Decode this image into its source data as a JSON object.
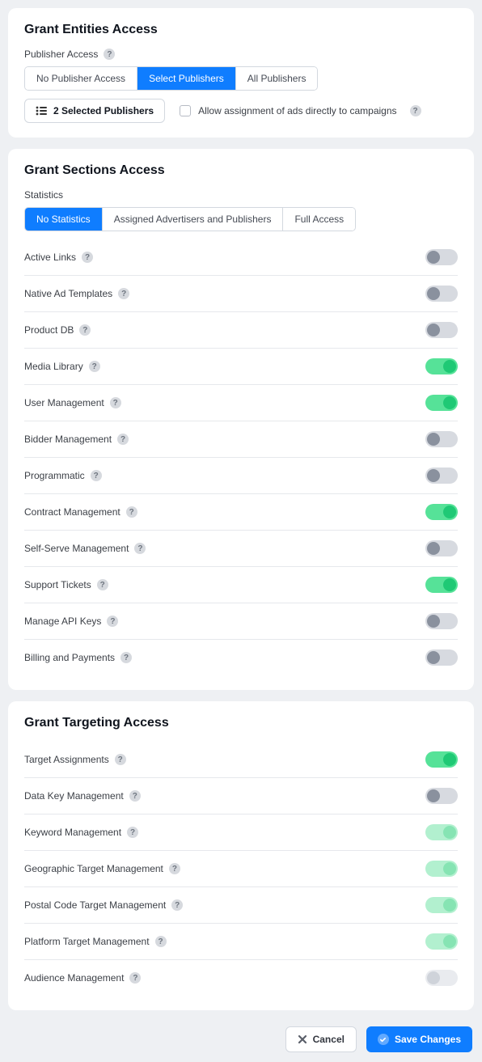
{
  "entities": {
    "title": "Grant Entities Access",
    "publisher_access_label": "Publisher Access",
    "segments": [
      "No Publisher Access",
      "Select Publishers",
      "All Publishers"
    ],
    "active_segment": 1,
    "selected_publishers_label": "2 Selected Publishers",
    "allow_assignment_label": "Allow assignment of ads directly to campaigns"
  },
  "sections": {
    "title": "Grant Sections Access",
    "statistics_label": "Statistics",
    "stats_segments": [
      "No Statistics",
      "Assigned Advertisers and Publishers",
      "Full Access"
    ],
    "stats_active": 0,
    "rows": [
      {
        "label": "Active Links",
        "state": "off"
      },
      {
        "label": "Native Ad Templates",
        "state": "off"
      },
      {
        "label": "Product DB",
        "state": "off"
      },
      {
        "label": "Media Library",
        "state": "on"
      },
      {
        "label": "User Management",
        "state": "on"
      },
      {
        "label": "Bidder Management",
        "state": "off"
      },
      {
        "label": "Programmatic",
        "state": "off"
      },
      {
        "label": "Contract Management",
        "state": "on"
      },
      {
        "label": "Self-Serve Management",
        "state": "off"
      },
      {
        "label": "Support Tickets",
        "state": "on"
      },
      {
        "label": "Manage API Keys",
        "state": "off"
      },
      {
        "label": "Billing and Payments",
        "state": "off"
      }
    ]
  },
  "targeting": {
    "title": "Grant Targeting Access",
    "rows": [
      {
        "label": "Target Assignments",
        "state": "on"
      },
      {
        "label": "Data Key Management",
        "state": "off"
      },
      {
        "label": "Keyword Management",
        "state": "on-light"
      },
      {
        "label": "Geographic Target Management",
        "state": "on-light"
      },
      {
        "label": "Postal Code Target Management",
        "state": "on-light"
      },
      {
        "label": "Platform Target Management",
        "state": "on-light"
      },
      {
        "label": "Audience Management",
        "state": "off-light"
      }
    ]
  },
  "footer": {
    "cancel": "Cancel",
    "save": "Save Changes"
  }
}
